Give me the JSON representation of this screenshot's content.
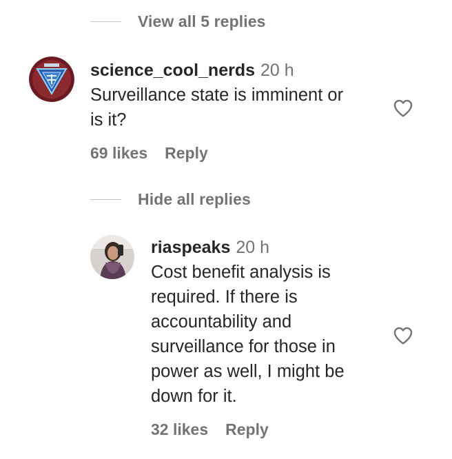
{
  "thread": {
    "view_replies_label": "View all 5 replies",
    "comment": {
      "username": "science_cool_nerds",
      "timestamp": "20 h",
      "text_lines": [
        "Surveillance state is imminent or",
        "is it?"
      ],
      "likes": "69 likes",
      "reply_label": "Reply",
      "avatar_icon": "science-logo-avatar"
    },
    "hide_replies_label": "Hide all replies",
    "reply": {
      "username": "riaspeaks",
      "timestamp": "20 h",
      "text_lines": [
        "Cost benefit analysis is",
        "required. If there is",
        "accountability and",
        "surveillance for those in",
        "power as well, I might be",
        "down for it."
      ],
      "likes": "32 likes",
      "reply_label": "Reply",
      "avatar_icon": "user-photo-avatar"
    }
  },
  "icons": {
    "like": "heart-icon"
  },
  "colors": {
    "primary_text": "#262626",
    "secondary_text": "#737373",
    "divider": "#c7c7c7"
  }
}
